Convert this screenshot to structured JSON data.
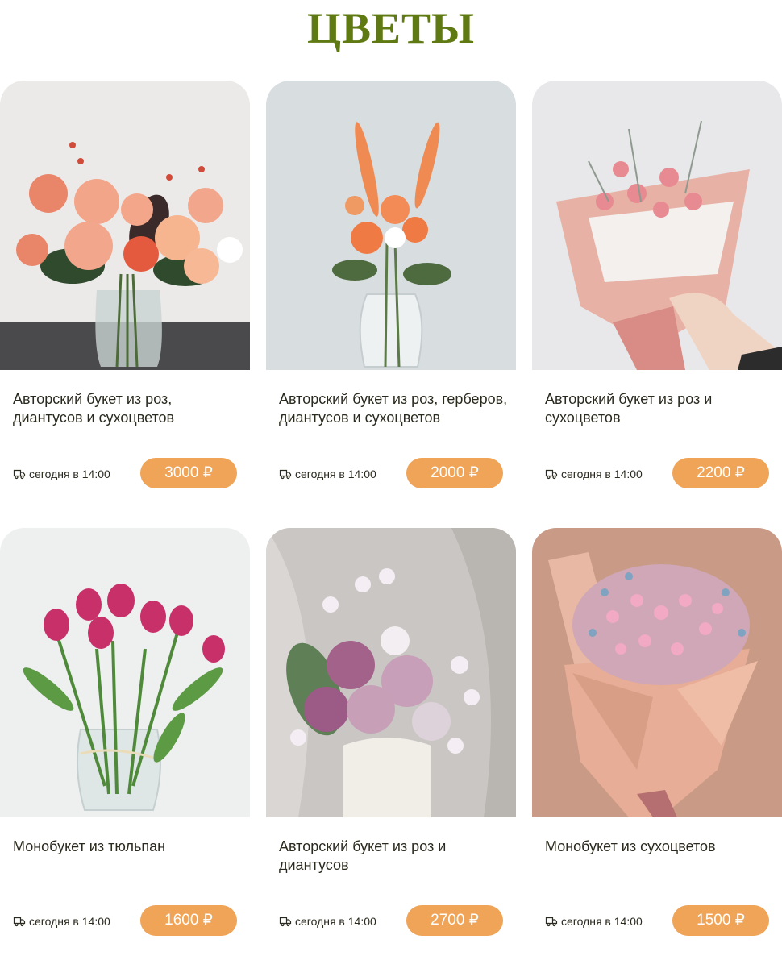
{
  "page": {
    "title": "ЦВЕТЫ"
  },
  "colors": {
    "accent": "#f0a457",
    "title": "#5f7a12"
  },
  "products": [
    {
      "name": "Авторский букет из роз, диантусов и сухоцветов",
      "delivery": "сегодня в 14:00",
      "price": "3000 ₽",
      "image": "peach-roses-bouquet-in-vase"
    },
    {
      "name": "Авторский букет из роз, герберов, диантусов и сухоцветов",
      "delivery": "сегодня в 14:00",
      "price": "2000 ₽",
      "image": "gladiolus-roses-bouquet-in-vase"
    },
    {
      "name": "Авторский букет из роз и сухоцветов",
      "delivery": "сегодня в 14:00",
      "price": "2200 ₽",
      "image": "pink-wrapped-bouquet-in-hand"
    },
    {
      "name": "Монобукет из тюльпан",
      "delivery": "сегодня в 14:00",
      "price": "1600 ₽",
      "image": "pink-tulips-in-jar"
    },
    {
      "name": "Авторский букет из роз и диантусов",
      "delivery": "сегодня в 14:00",
      "price": "2700 ₽",
      "image": "lilac-roses-orchids-in-vase"
    },
    {
      "name": "Монобукет из сухоцветов",
      "delivery": "сегодня в 14:00",
      "price": "1500 ₽",
      "image": "gypsophila-wrapped-bouquet"
    }
  ]
}
